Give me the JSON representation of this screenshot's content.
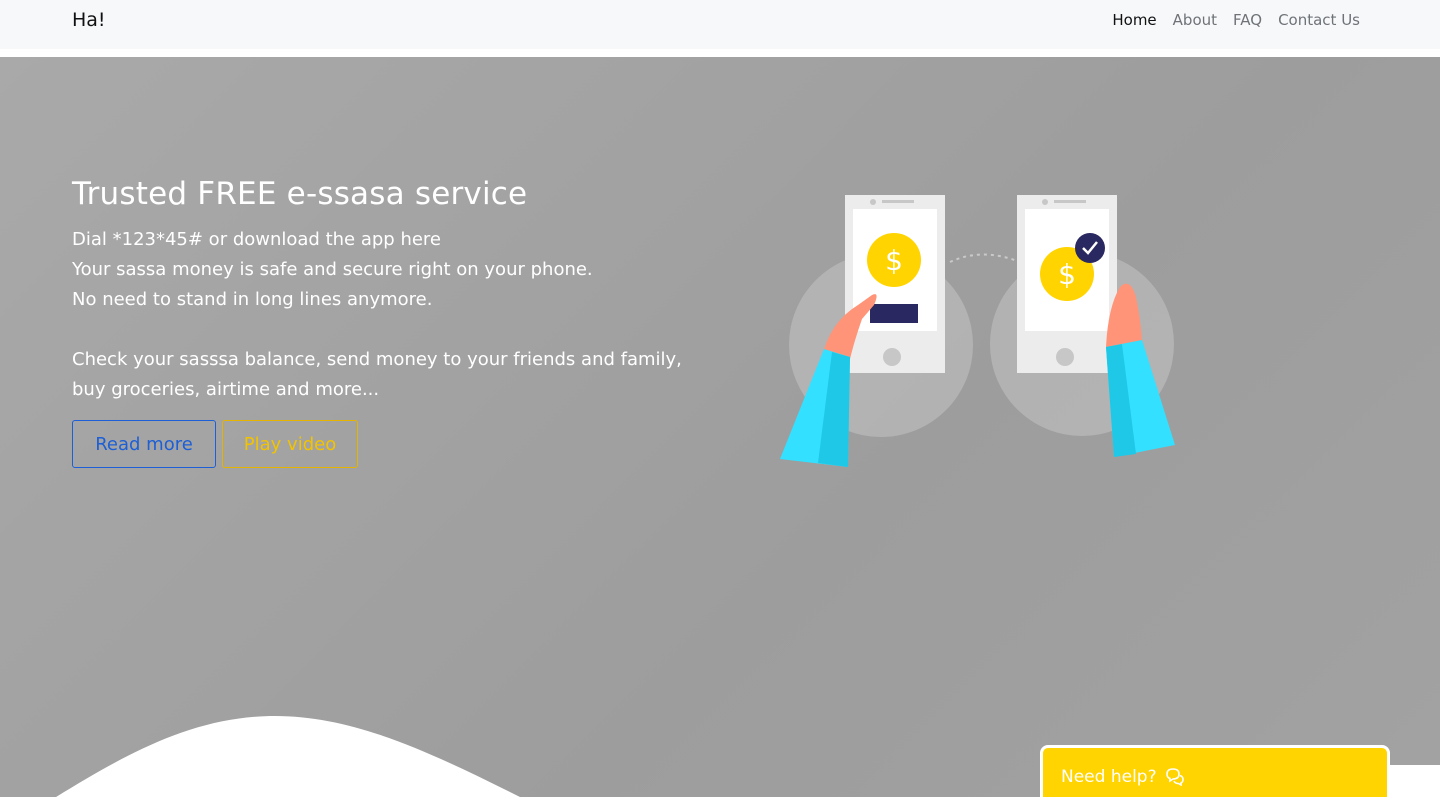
{
  "nav": {
    "brand": "Ha!",
    "links": [
      {
        "label": "Home",
        "active": true
      },
      {
        "label": "About",
        "active": false
      },
      {
        "label": "FAQ",
        "active": false
      },
      {
        "label": "Contact Us",
        "active": false
      }
    ]
  },
  "hero": {
    "title": "Trusted FREE e-ssasa service",
    "lines": [
      "Dial *123*45# or download the app here",
      "Your sassa money is safe and secure right on your phone.",
      "No need to stand in long lines anymore."
    ],
    "description": "Check your sasssa balance, send money to your friends and family, buy groceries, airtime and more...",
    "read_more": "Read more",
    "play_video": "Play video",
    "illustration_icons": [
      "phone-icon",
      "dollar-coin-icon",
      "check-badge-icon",
      "hand-icon"
    ]
  },
  "help_widget": {
    "label": "Need help?",
    "icon": "chat-bubbles-icon"
  },
  "colors": {
    "hero_bg": "#a3a3a3",
    "primary": "#1d5fd6",
    "accent": "#ffd400",
    "sleeve": "#33e0ff",
    "navy": "#2a2860"
  }
}
